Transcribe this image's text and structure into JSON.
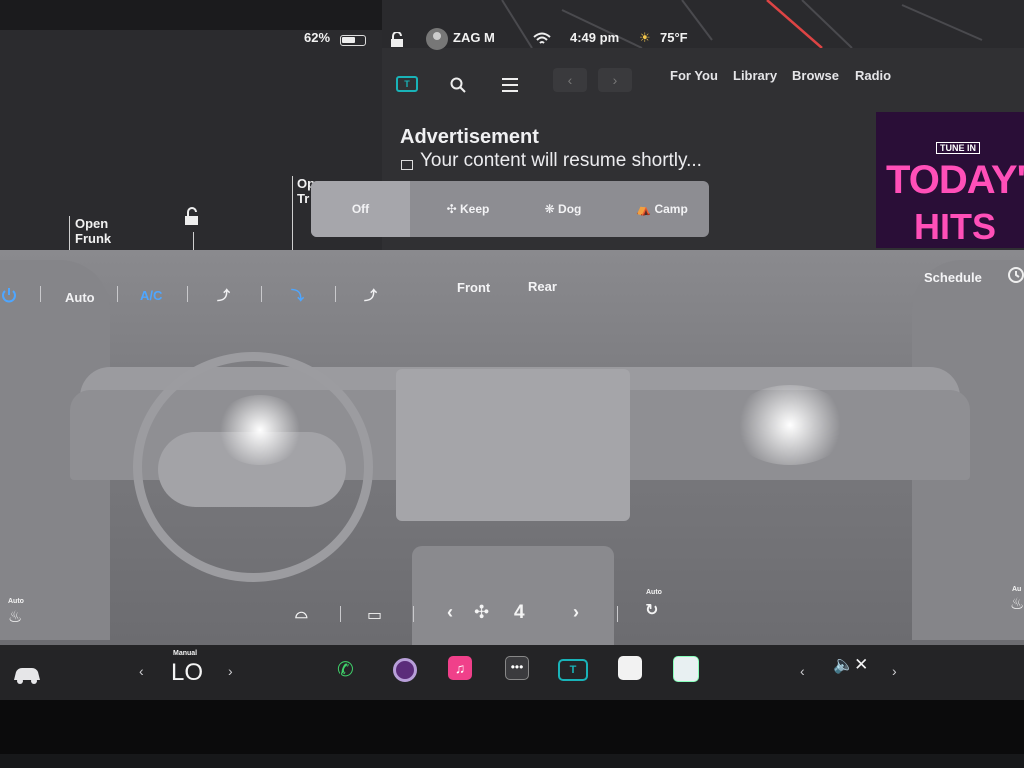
{
  "status": {
    "battery": "62%",
    "battery_fill": 0.62,
    "user": "ZAG M",
    "time": "4:49 pm",
    "weather_icon": "sun-icon",
    "temperature": "75°F"
  },
  "media": {
    "source_badge": "T",
    "nav": [
      "For You",
      "Library",
      "Browse",
      "Radio"
    ],
    "ad_title": "Advertisement",
    "ad_message": "Your content will resume shortly...",
    "album": {
      "brand": "TUNE IN",
      "line1": "TODAY'S",
      "line2": "HITS"
    }
  },
  "vehicle": {
    "frunk": [
      "Open",
      "Frunk"
    ],
    "trunk": [
      "Open",
      "Tr"
    ]
  },
  "climate_modes": {
    "options": [
      "Off",
      "Keep",
      "Dog",
      "Camp"
    ],
    "selected": "Off"
  },
  "climate": {
    "auto": "Auto",
    "ac": "A/C",
    "front": "Front",
    "rear": "Rear",
    "schedule": "Schedule",
    "fan_speed": "4",
    "seat_auto_left": "Auto",
    "recirc_auto": "Auto",
    "seat_auto_right": "Au"
  },
  "taskbar": {
    "temp_mode": "Manual",
    "temp": "LO",
    "apps": [
      "phone-icon",
      "camera-icon",
      "music-icon",
      "more-icon",
      "tunein-icon",
      "notes-icon",
      "calendar-icon"
    ],
    "tunein_badge": "T",
    "volume_icon": "volume-mute-icon"
  },
  "colors": {
    "accent_blue": "#4ea6ff",
    "tunein_teal": "#19b3b8",
    "album_pink": "#ff4fb8"
  }
}
